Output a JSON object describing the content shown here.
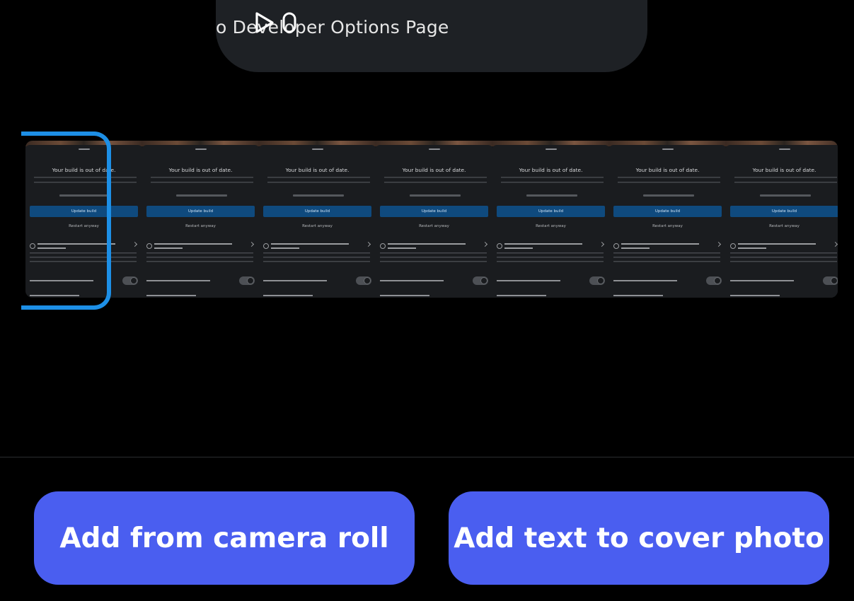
{
  "preview": {
    "text": "o Developer Options Page",
    "play_icon": "play-icon",
    "pause_icon": "pause-icon"
  },
  "filmstrip": {
    "frame_count": 7,
    "selected_index": 0,
    "selection_color": "#1d8fe6",
    "frame": {
      "title": "Your build is out of date.",
      "update_button": "Update build",
      "restart_link": "Restart anyway"
    }
  },
  "actions": {
    "camera_roll_label": "Add from camera roll",
    "cover_text_label": "Add text to cover photo",
    "accent_color": "#4a5ef0"
  }
}
